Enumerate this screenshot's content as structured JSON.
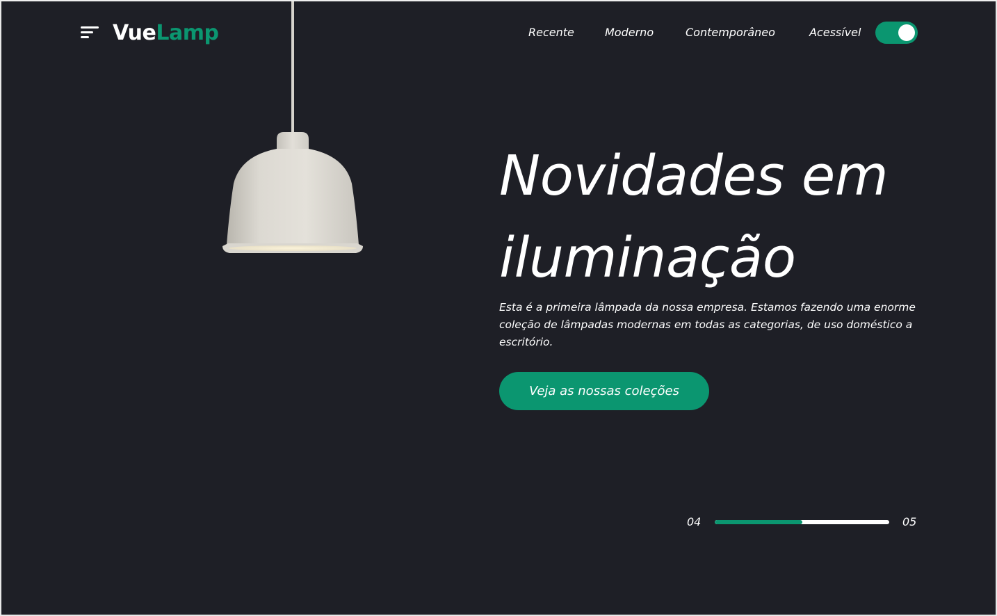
{
  "brand": {
    "name_part1": "Vue",
    "name_part2": "Lamp",
    "accent_color": "#0b9670",
    "background_color": "#1e1f26"
  },
  "header": {
    "menu_icon": "hamburger-menu-icon",
    "nav": {
      "items": [
        {
          "label": "Recente"
        },
        {
          "label": "Moderno"
        },
        {
          "label": "Contemporâneo"
        },
        {
          "label": "Acessível"
        }
      ]
    },
    "toggle": {
      "state": "on"
    }
  },
  "hero": {
    "title": "Novidades em iluminação",
    "description": "Esta é a primeira lâmpada da nossa empresa. Estamos fazendo uma enorme coleção de lâmpadas modernas em todas as categorias, de uso doméstico a escritório.",
    "cta_label": "Veja as nossas coleções",
    "image": "pendant-lamp-image"
  },
  "slider": {
    "current": "04",
    "total": "05",
    "progress": 0.5
  }
}
